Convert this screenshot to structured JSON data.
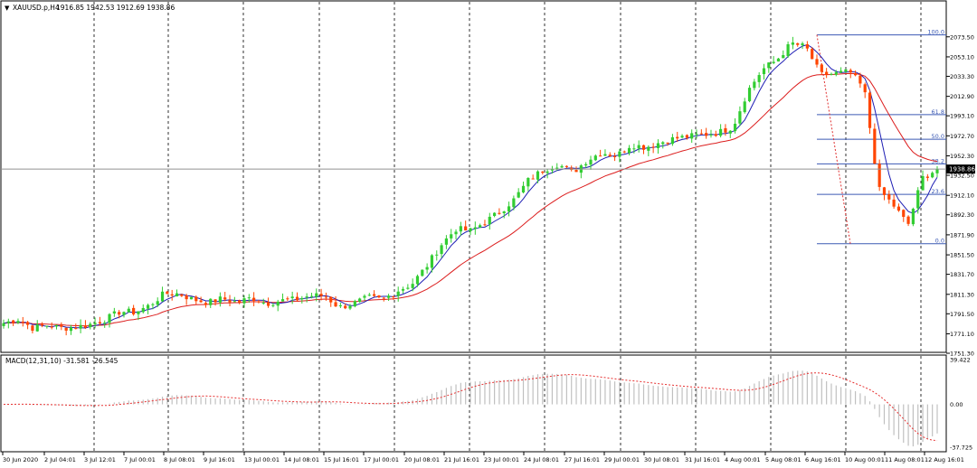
{
  "header": {
    "symbol": "XAUUSD.p,H4",
    "ohlc": "1916.85 1942.53 1912.69 1938.86"
  },
  "macd": {
    "title": "MACD(12,31,10) -31.581 -26.545",
    "yticks": [
      "39.422",
      "0.00",
      "-37.725"
    ],
    "yvalues": [
      39.422,
      0.0,
      -37.725
    ],
    "ylim": [
      -37.725,
      39.422
    ]
  },
  "colors": {
    "bull": "#32cd32",
    "bear": "#ff4500",
    "ma_fast": "#1e1eb4",
    "ma_slow": "#dc1e1e",
    "fib": "#3c5ab4",
    "grid": "#000000",
    "signal": "#e63232",
    "hist": "#c0c0c0"
  },
  "chart_data": [
    {
      "type": "candlestick",
      "title": "XAUUSD.p,H4",
      "ylim": [
        1751.3,
        2092.6
      ],
      "yticks": [
        "2073.50",
        "2053.10",
        "2033.30",
        "2012.90",
        "1993.10",
        "1972.70",
        "1952.30",
        "1932.50",
        "1912.10",
        "1892.30",
        "1871.90",
        "1851.50",
        "1831.70",
        "1811.30",
        "1791.50",
        "1771.10",
        "1751.30"
      ],
      "ytick_values": [
        2073.5,
        2053.1,
        2033.3,
        2012.9,
        1993.1,
        1972.7,
        1952.3,
        1932.5,
        1912.1,
        1892.3,
        1871.9,
        1851.5,
        1831.7,
        1811.3,
        1791.5,
        1771.1,
        1751.3
      ],
      "xticks": [
        "30 Jun 2020",
        "2 Jul 04:01",
        "3 Jul 12:01",
        "7 Jul 00:01",
        "8 Jul 08:01",
        "9 Jul 16:01",
        "13 Jul 00:01",
        "14 Jul 08:01",
        "15 Jul 16:01",
        "17 Jul 00:01",
        "20 Jul 08:01",
        "21 Jul 16:01",
        "23 Jul 00:01",
        "24 Jul 08:01",
        "27 Jul 16:01",
        "29 Jul 00:01",
        "30 Jul 08:01",
        "31 Jul 16:01",
        "4 Aug 00:01",
        "5 Aug 08:01",
        "6 Aug 16:01",
        "10 Aug 00:01",
        "11 Aug 08:01",
        "12 Aug 16:01"
      ],
      "current_price": "1938.86",
      "grid": "vertical dashed",
      "close_anchors": [
        1782,
        1786,
        1777,
        1780,
        1777,
        1778,
        1781,
        1786,
        1794,
        1793,
        1800,
        1812,
        1812,
        1806,
        1803,
        1807,
        1803,
        1808,
        1802,
        1805,
        1806,
        1810,
        1810,
        1798,
        1802,
        1808,
        1806,
        1815,
        1822,
        1840,
        1862,
        1878,
        1876,
        1885,
        1895,
        1908,
        1928,
        1938,
        1944,
        1935,
        1948,
        1956,
        1952,
        1964,
        1961,
        1966,
        1970,
        1972,
        1974,
        1976,
        1982,
        2018,
        2040,
        2050,
        2067,
        2063,
        2035,
        2036,
        2038,
        2020,
        1918,
        1902,
        1882,
        1930,
        1938.86
      ],
      "candle_count": 195,
      "fibonacci": {
        "high": 2075.5,
        "low": 1862.9,
        "levels": [
          "100.0",
          "61.8",
          "50.0",
          "38.2",
          "23.6",
          "0.0"
        ],
        "level_values": [
          100.0,
          61.8,
          50.0,
          38.2,
          23.6,
          0.0
        ]
      }
    },
    {
      "type": "histogram",
      "title": "MACD(12,31,10) -31.581 -26.545",
      "ylim": [
        -37.725,
        39.422
      ]
    }
  ]
}
